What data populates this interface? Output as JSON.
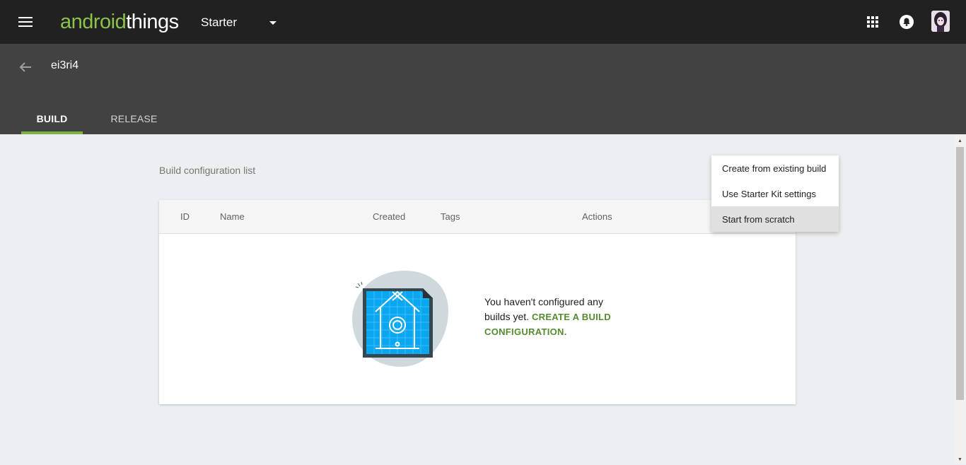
{
  "topbar": {
    "logo_part1": "android",
    "logo_part2": "things",
    "project_selector": "Starter"
  },
  "header": {
    "project_name": "ei3ri4",
    "tabs": [
      {
        "label": "BUILD",
        "active": true
      },
      {
        "label": "RELEASE",
        "active": false
      }
    ]
  },
  "main": {
    "section_title": "Build configuration list",
    "table": {
      "columns": [
        "ID",
        "Name",
        "Created",
        "Tags",
        "Actions"
      ]
    },
    "empty_state": {
      "text": "You haven't configured any builds yet.",
      "link": "CREATE A BUILD CONFIGURATION."
    }
  },
  "dropdown": {
    "items": [
      {
        "label": "Create from existing build"
      },
      {
        "label": "Use Starter Kit settings"
      },
      {
        "label": "Start from scratch"
      }
    ]
  },
  "icons": {
    "menu": "menu-icon",
    "dropdown": "arrow-drop-down-icon",
    "apps": "apps-grid-icon",
    "notifications": "notifications-bell-icon",
    "back": "arrow-back-icon"
  },
  "colors": {
    "accent_green": "#7cb342",
    "logo_green": "#8bc34a",
    "link_green": "#558b2f",
    "topbar": "#212121",
    "subheader": "#424242",
    "background": "#eceff1"
  }
}
